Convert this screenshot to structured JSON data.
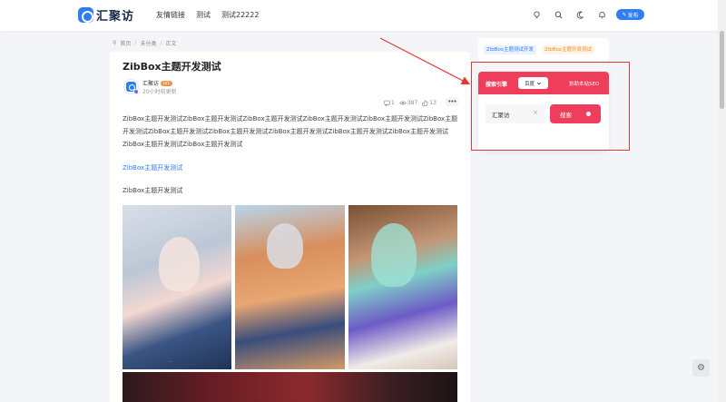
{
  "header": {
    "logo_text": "汇聚访",
    "nav": [
      "友情链接",
      "测试",
      "测试22222"
    ],
    "publish_label": "发布"
  },
  "breadcrumb": [
    "首页",
    "未分类",
    "正文"
  ],
  "post": {
    "title": "ZibBox主题开发测试",
    "author": "汇聚访",
    "author_level": "LV1",
    "time": "20小时前更新",
    "stats": {
      "comments": "1",
      "views": "387",
      "likes": "13"
    },
    "body": "ZibBox主题开发测试ZibBox主题开发测试ZibBox主题开发测试ZibBox主题开发测试ZibBox主题开发测试ZibBox主题开发测试ZibBox主题开发测试ZibBox主题开发测试ZibBox主题开发测试ZibBox主题开发测试ZibBox主题开发测试ZibBox主题开发测试ZibBox主题开发测试",
    "link": "ZibBox主题开发测试",
    "sub": "ZibBox主题开发测试"
  },
  "sidebar": {
    "tags": [
      "ZibBox主题测试开发",
      "ZibBox主题开发测试"
    ],
    "search": {
      "title": "搜索引擎",
      "engine": "百度",
      "seo_link": "协助本站SEO",
      "input_value": "汇聚访",
      "button_label": "搜索"
    }
  },
  "colors": {
    "primary": "#2f7df6",
    "search_accent": "#ef3e5b",
    "annotation": "#e53935"
  }
}
